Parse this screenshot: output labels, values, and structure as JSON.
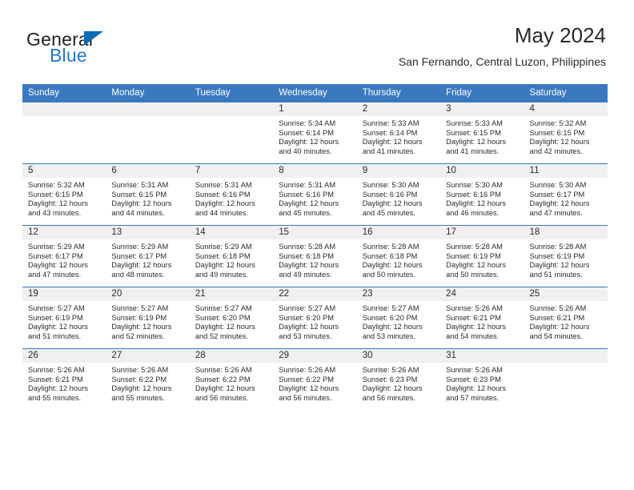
{
  "brand": {
    "name_part1": "General",
    "name_part2": "Blue",
    "accent_color": "#1b7ac9",
    "triangle_color": "#0b6cb8"
  },
  "header": {
    "title": "May 2024",
    "subtitle": "San Fernando, Central Luzon, Philippines"
  },
  "theme": {
    "header_row_bg": "#3a79c0",
    "header_row_text": "#ffffff",
    "daynum_band_bg": "#f0f0f0",
    "cell_border": "#3a79c0"
  },
  "weekday_headers": [
    "Sunday",
    "Monday",
    "Tuesday",
    "Wednesday",
    "Thursday",
    "Friday",
    "Saturday"
  ],
  "labels": {
    "sunrise_prefix": "Sunrise:",
    "sunset_prefix": "Sunset:",
    "daylight_prefix": "Daylight:"
  },
  "weeks": [
    [
      {
        "date": "",
        "empty": true
      },
      {
        "date": "",
        "empty": true
      },
      {
        "date": "",
        "empty": true
      },
      {
        "date": "1",
        "sunrise": "Sunrise: 5:34 AM",
        "sunset": "Sunset: 6:14 PM",
        "daylight_line1": "Daylight: 12 hours",
        "daylight_line2": "and 40 minutes."
      },
      {
        "date": "2",
        "sunrise": "Sunrise: 5:33 AM",
        "sunset": "Sunset: 6:14 PM",
        "daylight_line1": "Daylight: 12 hours",
        "daylight_line2": "and 41 minutes."
      },
      {
        "date": "3",
        "sunrise": "Sunrise: 5:33 AM",
        "sunset": "Sunset: 6:15 PM",
        "daylight_line1": "Daylight: 12 hours",
        "daylight_line2": "and 41 minutes."
      },
      {
        "date": "4",
        "sunrise": "Sunrise: 5:32 AM",
        "sunset": "Sunset: 6:15 PM",
        "daylight_line1": "Daylight: 12 hours",
        "daylight_line2": "and 42 minutes."
      }
    ],
    [
      {
        "date": "5",
        "sunrise": "Sunrise: 5:32 AM",
        "sunset": "Sunset: 6:15 PM",
        "daylight_line1": "Daylight: 12 hours",
        "daylight_line2": "and 43 minutes."
      },
      {
        "date": "6",
        "sunrise": "Sunrise: 5:31 AM",
        "sunset": "Sunset: 6:15 PM",
        "daylight_line1": "Daylight: 12 hours",
        "daylight_line2": "and 44 minutes."
      },
      {
        "date": "7",
        "sunrise": "Sunrise: 5:31 AM",
        "sunset": "Sunset: 6:16 PM",
        "daylight_line1": "Daylight: 12 hours",
        "daylight_line2": "and 44 minutes."
      },
      {
        "date": "8",
        "sunrise": "Sunrise: 5:31 AM",
        "sunset": "Sunset: 6:16 PM",
        "daylight_line1": "Daylight: 12 hours",
        "daylight_line2": "and 45 minutes."
      },
      {
        "date": "9",
        "sunrise": "Sunrise: 5:30 AM",
        "sunset": "Sunset: 6:16 PM",
        "daylight_line1": "Daylight: 12 hours",
        "daylight_line2": "and 45 minutes."
      },
      {
        "date": "10",
        "sunrise": "Sunrise: 5:30 AM",
        "sunset": "Sunset: 6:16 PM",
        "daylight_line1": "Daylight: 12 hours",
        "daylight_line2": "and 46 minutes."
      },
      {
        "date": "11",
        "sunrise": "Sunrise: 5:30 AM",
        "sunset": "Sunset: 6:17 PM",
        "daylight_line1": "Daylight: 12 hours",
        "daylight_line2": "and 47 minutes."
      }
    ],
    [
      {
        "date": "12",
        "sunrise": "Sunrise: 5:29 AM",
        "sunset": "Sunset: 6:17 PM",
        "daylight_line1": "Daylight: 12 hours",
        "daylight_line2": "and 47 minutes."
      },
      {
        "date": "13",
        "sunrise": "Sunrise: 5:29 AM",
        "sunset": "Sunset: 6:17 PM",
        "daylight_line1": "Daylight: 12 hours",
        "daylight_line2": "and 48 minutes."
      },
      {
        "date": "14",
        "sunrise": "Sunrise: 5:29 AM",
        "sunset": "Sunset: 6:18 PM",
        "daylight_line1": "Daylight: 12 hours",
        "daylight_line2": "and 49 minutes."
      },
      {
        "date": "15",
        "sunrise": "Sunrise: 5:28 AM",
        "sunset": "Sunset: 6:18 PM",
        "daylight_line1": "Daylight: 12 hours",
        "daylight_line2": "and 49 minutes."
      },
      {
        "date": "16",
        "sunrise": "Sunrise: 5:28 AM",
        "sunset": "Sunset: 6:18 PM",
        "daylight_line1": "Daylight: 12 hours",
        "daylight_line2": "and 50 minutes."
      },
      {
        "date": "17",
        "sunrise": "Sunrise: 5:28 AM",
        "sunset": "Sunset: 6:19 PM",
        "daylight_line1": "Daylight: 12 hours",
        "daylight_line2": "and 50 minutes."
      },
      {
        "date": "18",
        "sunrise": "Sunrise: 5:28 AM",
        "sunset": "Sunset: 6:19 PM",
        "daylight_line1": "Daylight: 12 hours",
        "daylight_line2": "and 51 minutes."
      }
    ],
    [
      {
        "date": "19",
        "sunrise": "Sunrise: 5:27 AM",
        "sunset": "Sunset: 6:19 PM",
        "daylight_line1": "Daylight: 12 hours",
        "daylight_line2": "and 51 minutes."
      },
      {
        "date": "20",
        "sunrise": "Sunrise: 5:27 AM",
        "sunset": "Sunset: 6:19 PM",
        "daylight_line1": "Daylight: 12 hours",
        "daylight_line2": "and 52 minutes."
      },
      {
        "date": "21",
        "sunrise": "Sunrise: 5:27 AM",
        "sunset": "Sunset: 6:20 PM",
        "daylight_line1": "Daylight: 12 hours",
        "daylight_line2": "and 52 minutes."
      },
      {
        "date": "22",
        "sunrise": "Sunrise: 5:27 AM",
        "sunset": "Sunset: 6:20 PM",
        "daylight_line1": "Daylight: 12 hours",
        "daylight_line2": "and 53 minutes."
      },
      {
        "date": "23",
        "sunrise": "Sunrise: 5:27 AM",
        "sunset": "Sunset: 6:20 PM",
        "daylight_line1": "Daylight: 12 hours",
        "daylight_line2": "and 53 minutes."
      },
      {
        "date": "24",
        "sunrise": "Sunrise: 5:26 AM",
        "sunset": "Sunset: 6:21 PM",
        "daylight_line1": "Daylight: 12 hours",
        "daylight_line2": "and 54 minutes."
      },
      {
        "date": "25",
        "sunrise": "Sunrise: 5:26 AM",
        "sunset": "Sunset: 6:21 PM",
        "daylight_line1": "Daylight: 12 hours",
        "daylight_line2": "and 54 minutes."
      }
    ],
    [
      {
        "date": "26",
        "sunrise": "Sunrise: 5:26 AM",
        "sunset": "Sunset: 6:21 PM",
        "daylight_line1": "Daylight: 12 hours",
        "daylight_line2": "and 55 minutes."
      },
      {
        "date": "27",
        "sunrise": "Sunrise: 5:26 AM",
        "sunset": "Sunset: 6:22 PM",
        "daylight_line1": "Daylight: 12 hours",
        "daylight_line2": "and 55 minutes."
      },
      {
        "date": "28",
        "sunrise": "Sunrise: 5:26 AM",
        "sunset": "Sunset: 6:22 PM",
        "daylight_line1": "Daylight: 12 hours",
        "daylight_line2": "and 56 minutes."
      },
      {
        "date": "29",
        "sunrise": "Sunrise: 5:26 AM",
        "sunset": "Sunset: 6:22 PM",
        "daylight_line1": "Daylight: 12 hours",
        "daylight_line2": "and 56 minutes."
      },
      {
        "date": "30",
        "sunrise": "Sunrise: 5:26 AM",
        "sunset": "Sunset: 6:23 PM",
        "daylight_line1": "Daylight: 12 hours",
        "daylight_line2": "and 56 minutes."
      },
      {
        "date": "31",
        "sunrise": "Sunrise: 5:26 AM",
        "sunset": "Sunset: 6:23 PM",
        "daylight_line1": "Daylight: 12 hours",
        "daylight_line2": "and 57 minutes."
      },
      {
        "date": "",
        "empty": true
      }
    ]
  ]
}
